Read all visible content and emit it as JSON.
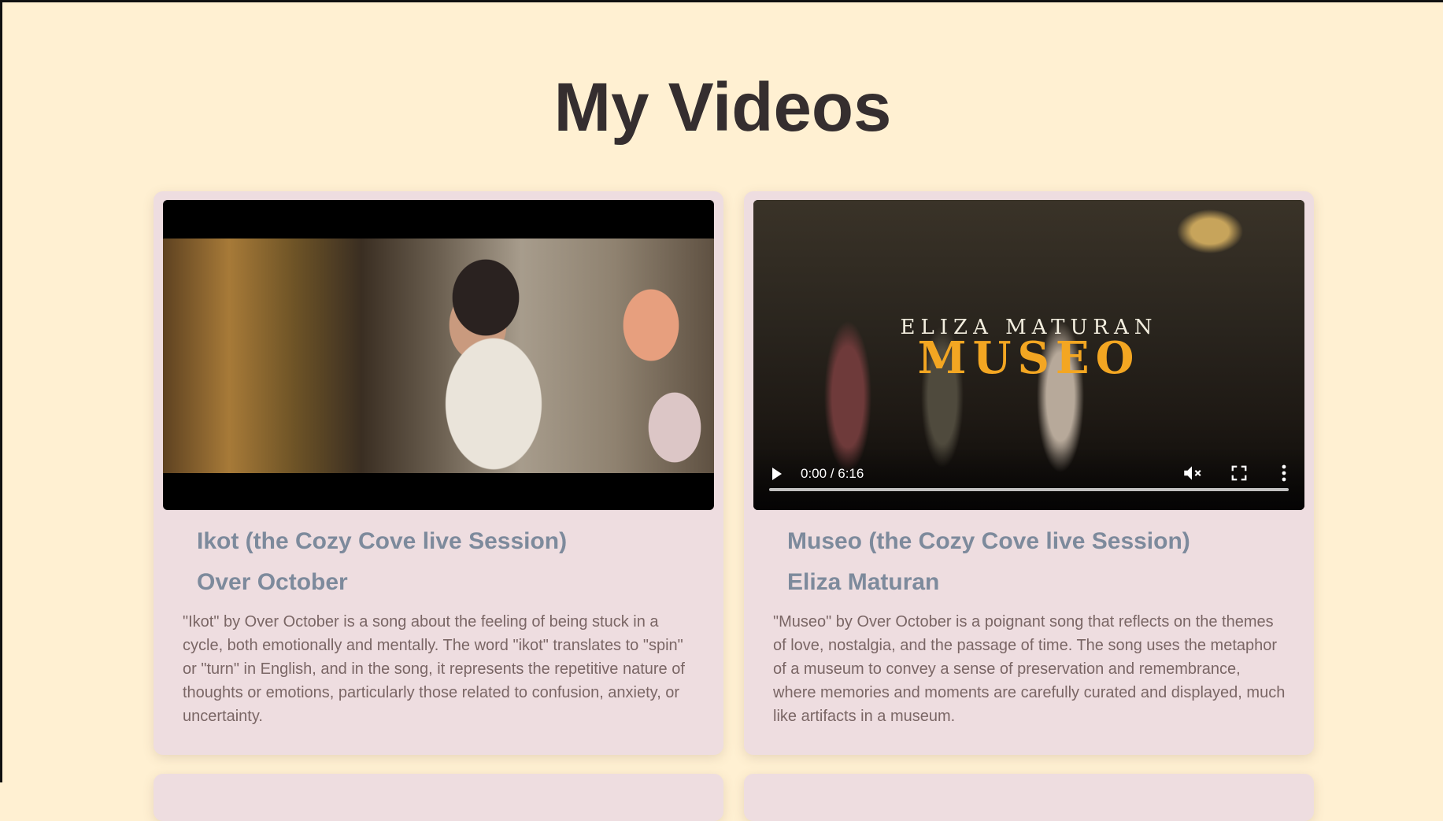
{
  "page": {
    "title": "My Videos"
  },
  "videos": [
    {
      "title": "Ikot (the Cozy Cove live Session)",
      "artist": "Over October",
      "description": "\"Ikot\" by Over October is a song about the feeling of being stuck in a cycle, both emotionally and mentally. The word \"ikot\" translates to \"spin\" or \"turn\" in English, and in the song, it represents the repetitive nature of thoughts or emotions, particularly those related to confusion, anxiety, or uncertainty."
    },
    {
      "title": "Museo (the Cozy Cove live Session)",
      "artist": "Eliza Maturan",
      "description": "\"Museo\" by Over October is a poignant song that reflects on the themes of love, nostalgia, and the passage of time. The song uses the metaphor of a museum to convey a sense of preservation and remembrance, where memories and moments are carefully curated and displayed, much like artifacts in a museum.",
      "overlay_artist": "ELIZA MATURAN",
      "overlay_title": "MUSEO",
      "player": {
        "time": "0:00 / 6:16",
        "icons": [
          "play-icon",
          "mute-icon",
          "fullscreen-icon",
          "more-icon"
        ]
      }
    }
  ],
  "colors": {
    "background": "#FFF0D2",
    "card": "#EEDDE0",
    "heading": "#352E2F",
    "accent": "#7D8A9C",
    "body_text": "#7A6665",
    "overlay_title": "#F3A622"
  }
}
